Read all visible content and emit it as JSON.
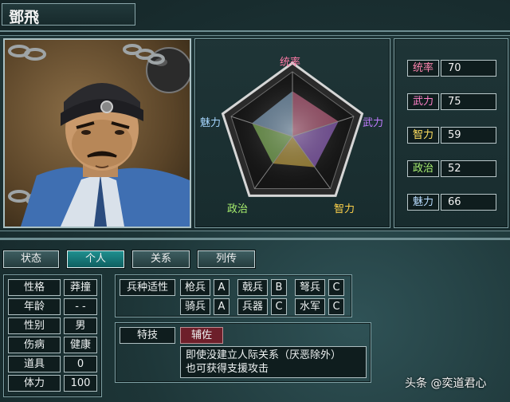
{
  "character": {
    "name": "鄧飛"
  },
  "radar": {
    "labels": {
      "top": "统率",
      "right": "武力",
      "bottom_right": "智力",
      "bottom_left": "政治",
      "left": "魅力"
    },
    "values": {
      "leadership": 70,
      "war": 75,
      "intelligence": 59,
      "politics": 52,
      "charm": 66
    },
    "max": 100,
    "colors": {
      "top": "#ff7aa6",
      "right": "#c07cff",
      "bottom_right": "#ffd24a",
      "bottom_left": "#a8f06e",
      "left": "#a6d6ff"
    }
  },
  "stats": [
    {
      "label": "统率",
      "value": "70",
      "color": "#ff86b0"
    },
    {
      "label": "武力",
      "value": "75",
      "color": "#ff80c8"
    },
    {
      "label": "智力",
      "value": "59",
      "color": "#ffe060"
    },
    {
      "label": "政治",
      "value": "52",
      "color": "#a8f070"
    },
    {
      "label": "魅力",
      "value": "66",
      "color": "#b8dcff"
    }
  ],
  "tabs": [
    {
      "label": "状态",
      "active": false
    },
    {
      "label": "个人",
      "active": true
    },
    {
      "label": "关系",
      "active": false
    },
    {
      "label": "列传",
      "active": false
    }
  ],
  "personal": [
    {
      "label": "性格",
      "value": "莽撞"
    },
    {
      "label": "年龄",
      "value": "- -"
    },
    {
      "label": "性别",
      "value": "男"
    },
    {
      "label": "伤病",
      "value": "健康"
    },
    {
      "label": "道具",
      "value": "0"
    },
    {
      "label": "体力",
      "value": "100"
    }
  ],
  "aptitude": {
    "title": "兵种适性",
    "rows": [
      [
        {
          "unit": "枪兵",
          "grade": "A"
        },
        {
          "unit": "戟兵",
          "grade": "B"
        },
        {
          "unit": "弩兵",
          "grade": "C"
        }
      ],
      [
        {
          "unit": "骑兵",
          "grade": "A"
        },
        {
          "unit": "兵器",
          "grade": "C"
        },
        {
          "unit": "水军",
          "grade": "C"
        }
      ]
    ]
  },
  "skill": {
    "title": "特技",
    "name": "辅佐",
    "desc_line1": "即使没建立人际关系（厌恶除外）",
    "desc_line2": "也可获得支援攻击"
  },
  "watermark": "头条 @奕道君心"
}
